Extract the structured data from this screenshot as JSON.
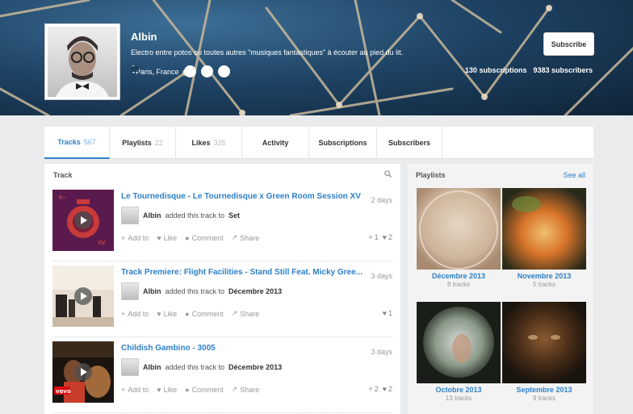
{
  "profile": {
    "name": "Albin",
    "bio": "Electro entre potos ou toutes autres \"musiques fantastiques\" à écouter au pied du lit.",
    "location": "Paris, France",
    "subscribe_label": "Subscribe",
    "subscriptions": "130 subscriptions",
    "subscribers": "9383 subscribers"
  },
  "tabs": [
    {
      "label": "Tracks",
      "count": "567"
    },
    {
      "label": "Playlists",
      "count": "22"
    },
    {
      "label": "Likes",
      "count": "325"
    },
    {
      "label": "Activity",
      "count": ""
    },
    {
      "label": "Subscriptions",
      "count": ""
    },
    {
      "label": "Subscribers",
      "count": ""
    }
  ],
  "tracks_panel": {
    "title": "Track",
    "items": [
      {
        "title": "Le Tournedisque - Le Tournedisque x Green Room Session XV",
        "time": "2 days",
        "user": "Albin",
        "added_text": "added this track to",
        "playlist": "Set",
        "reposts": "1",
        "likes": "2"
      },
      {
        "title": "Track Premiere: Flight Facilities - Stand Still Feat. Micky Gree...",
        "time": "3 days",
        "user": "Albin",
        "added_text": "added this track to",
        "playlist": "Décembre 2013",
        "reposts": "",
        "likes": "1"
      },
      {
        "title": "Childish Gambino - 3005",
        "time": "3 days",
        "user": "Albin",
        "added_text": "added this track to",
        "playlist": "Décembre 2013",
        "reposts": "2",
        "likes": "2"
      }
    ],
    "actions": {
      "add": "Add to",
      "like": "Like",
      "comment": "Comment",
      "share": "Share"
    }
  },
  "playlists_panel": {
    "title": "Playlists",
    "see_all": "See all",
    "items": [
      {
        "name": "Décembre 2013",
        "count": "8 tracks"
      },
      {
        "name": "Novembre 2013",
        "count": "5 tracks"
      },
      {
        "name": "Octobre 2013",
        "count": "13 tracks"
      },
      {
        "name": "Septembre 2013",
        "count": "9 tracks"
      }
    ]
  },
  "colors": {
    "accent": "#2e80c8",
    "cover": "#1f4466"
  }
}
